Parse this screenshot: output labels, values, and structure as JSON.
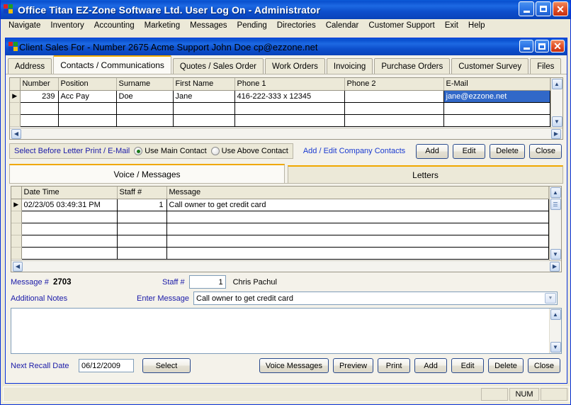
{
  "app": {
    "title": "Office Titan  EZ-Zone Software Ltd.   User Log On - Administrator",
    "icon": "windows-flag-icon",
    "minimize_label": "_",
    "maximize_label": "□",
    "close_label": "✕"
  },
  "menubar": {
    "items": [
      {
        "label": "Navigate"
      },
      {
        "label": "Inventory"
      },
      {
        "label": "Accounting"
      },
      {
        "label": "Marketing"
      },
      {
        "label": "Messages"
      },
      {
        "label": "Pending"
      },
      {
        "label": "Directories"
      },
      {
        "label": "Calendar"
      },
      {
        "label": "Customer Support"
      },
      {
        "label": "Exit"
      },
      {
        "label": "Help"
      }
    ]
  },
  "child_window": {
    "title": "Client Sales For  - Number 2675   Acme Support   John Doe   cp@ezzone.net",
    "minimize_label": "_",
    "maximize_label": "□",
    "close_label": "✕"
  },
  "tabs": [
    {
      "label": "Address",
      "active": false
    },
    {
      "label": "Contacts / Communications",
      "active": true
    },
    {
      "label": "Quotes / Sales Order",
      "active": false
    },
    {
      "label": "Work Orders",
      "active": false
    },
    {
      "label": "Invoicing",
      "active": false
    },
    {
      "label": "Purchase Orders",
      "active": false
    },
    {
      "label": "Customer Survey",
      "active": false
    },
    {
      "label": "Files",
      "active": false
    }
  ],
  "contacts_grid": {
    "columns": [
      "Number",
      "Position",
      "Surname",
      "First Name",
      "Phone 1",
      "Phone 2",
      "E-Mail"
    ],
    "rows": [
      {
        "selected": true,
        "number": "239",
        "position": "Acc Pay",
        "surname": "Doe",
        "first_name": "Jane",
        "phone1": "416-222-333 x 12345",
        "phone2": "",
        "email": "jane@ezzone.net"
      },
      {
        "selected": false,
        "number": "",
        "position": "",
        "surname": "",
        "first_name": "",
        "phone1": "",
        "phone2": "",
        "email": ""
      },
      {
        "selected": false,
        "number": "",
        "position": "",
        "surname": "",
        "first_name": "",
        "phone1": "",
        "phone2": "",
        "email": ""
      }
    ]
  },
  "options_bar": {
    "prompt": "Select Before Letter Print / E-Mail",
    "radio_main": "Use Main Contact",
    "radio_above": "Use Above Contact",
    "selected_radio": "main",
    "link": "Add / Edit Company Contacts",
    "buttons": [
      "Add",
      "Edit",
      "Delete",
      "Close"
    ]
  },
  "lower_tabs": [
    {
      "label": "Voice / Messages",
      "active": true
    },
    {
      "label": "Letters",
      "active": false
    }
  ],
  "messages_grid": {
    "columns": [
      "Date Time",
      "Staff #",
      "Message"
    ],
    "rows": [
      {
        "date_time": "02/23/05 03:49:31 PM",
        "staff": "1",
        "message": "Call owner to get credit card",
        "current": true
      },
      {
        "date_time": "",
        "staff": "",
        "message": "",
        "current": false
      },
      {
        "date_time": "",
        "staff": "",
        "message": "",
        "current": false
      },
      {
        "date_time": "",
        "staff": "",
        "message": "",
        "current": false
      },
      {
        "date_time": "",
        "staff": "",
        "message": "",
        "current": false
      }
    ]
  },
  "message_form": {
    "message_number_label": "Message #",
    "message_number_value": "2703",
    "staff_label": "Staff #",
    "staff_value": "1",
    "staff_name": "Chris Pachul",
    "additional_notes_label": "Additional Notes",
    "enter_message_label": "Enter Message",
    "enter_message_value": "Call owner to get credit card",
    "additional_notes_value": ""
  },
  "bottom_bar": {
    "recall_label": "Next Recall Date",
    "recall_value": "06/12/2009",
    "select_button": "Select",
    "buttons": [
      "Voice Messages",
      "Preview",
      "Print",
      "Add",
      "Edit",
      "Delete",
      "Close"
    ]
  },
  "statusbar": {
    "message": "",
    "pane2": "",
    "num_indicator": "NUM",
    "pane4": ""
  },
  "colors": {
    "title_blue": "#0a50cf",
    "accent_orange": "#f0a800",
    "selection_blue": "#3168c8",
    "label_blue": "#1a1aa8",
    "link_blue": "#1a3ad0",
    "face": "#ece9d8"
  }
}
